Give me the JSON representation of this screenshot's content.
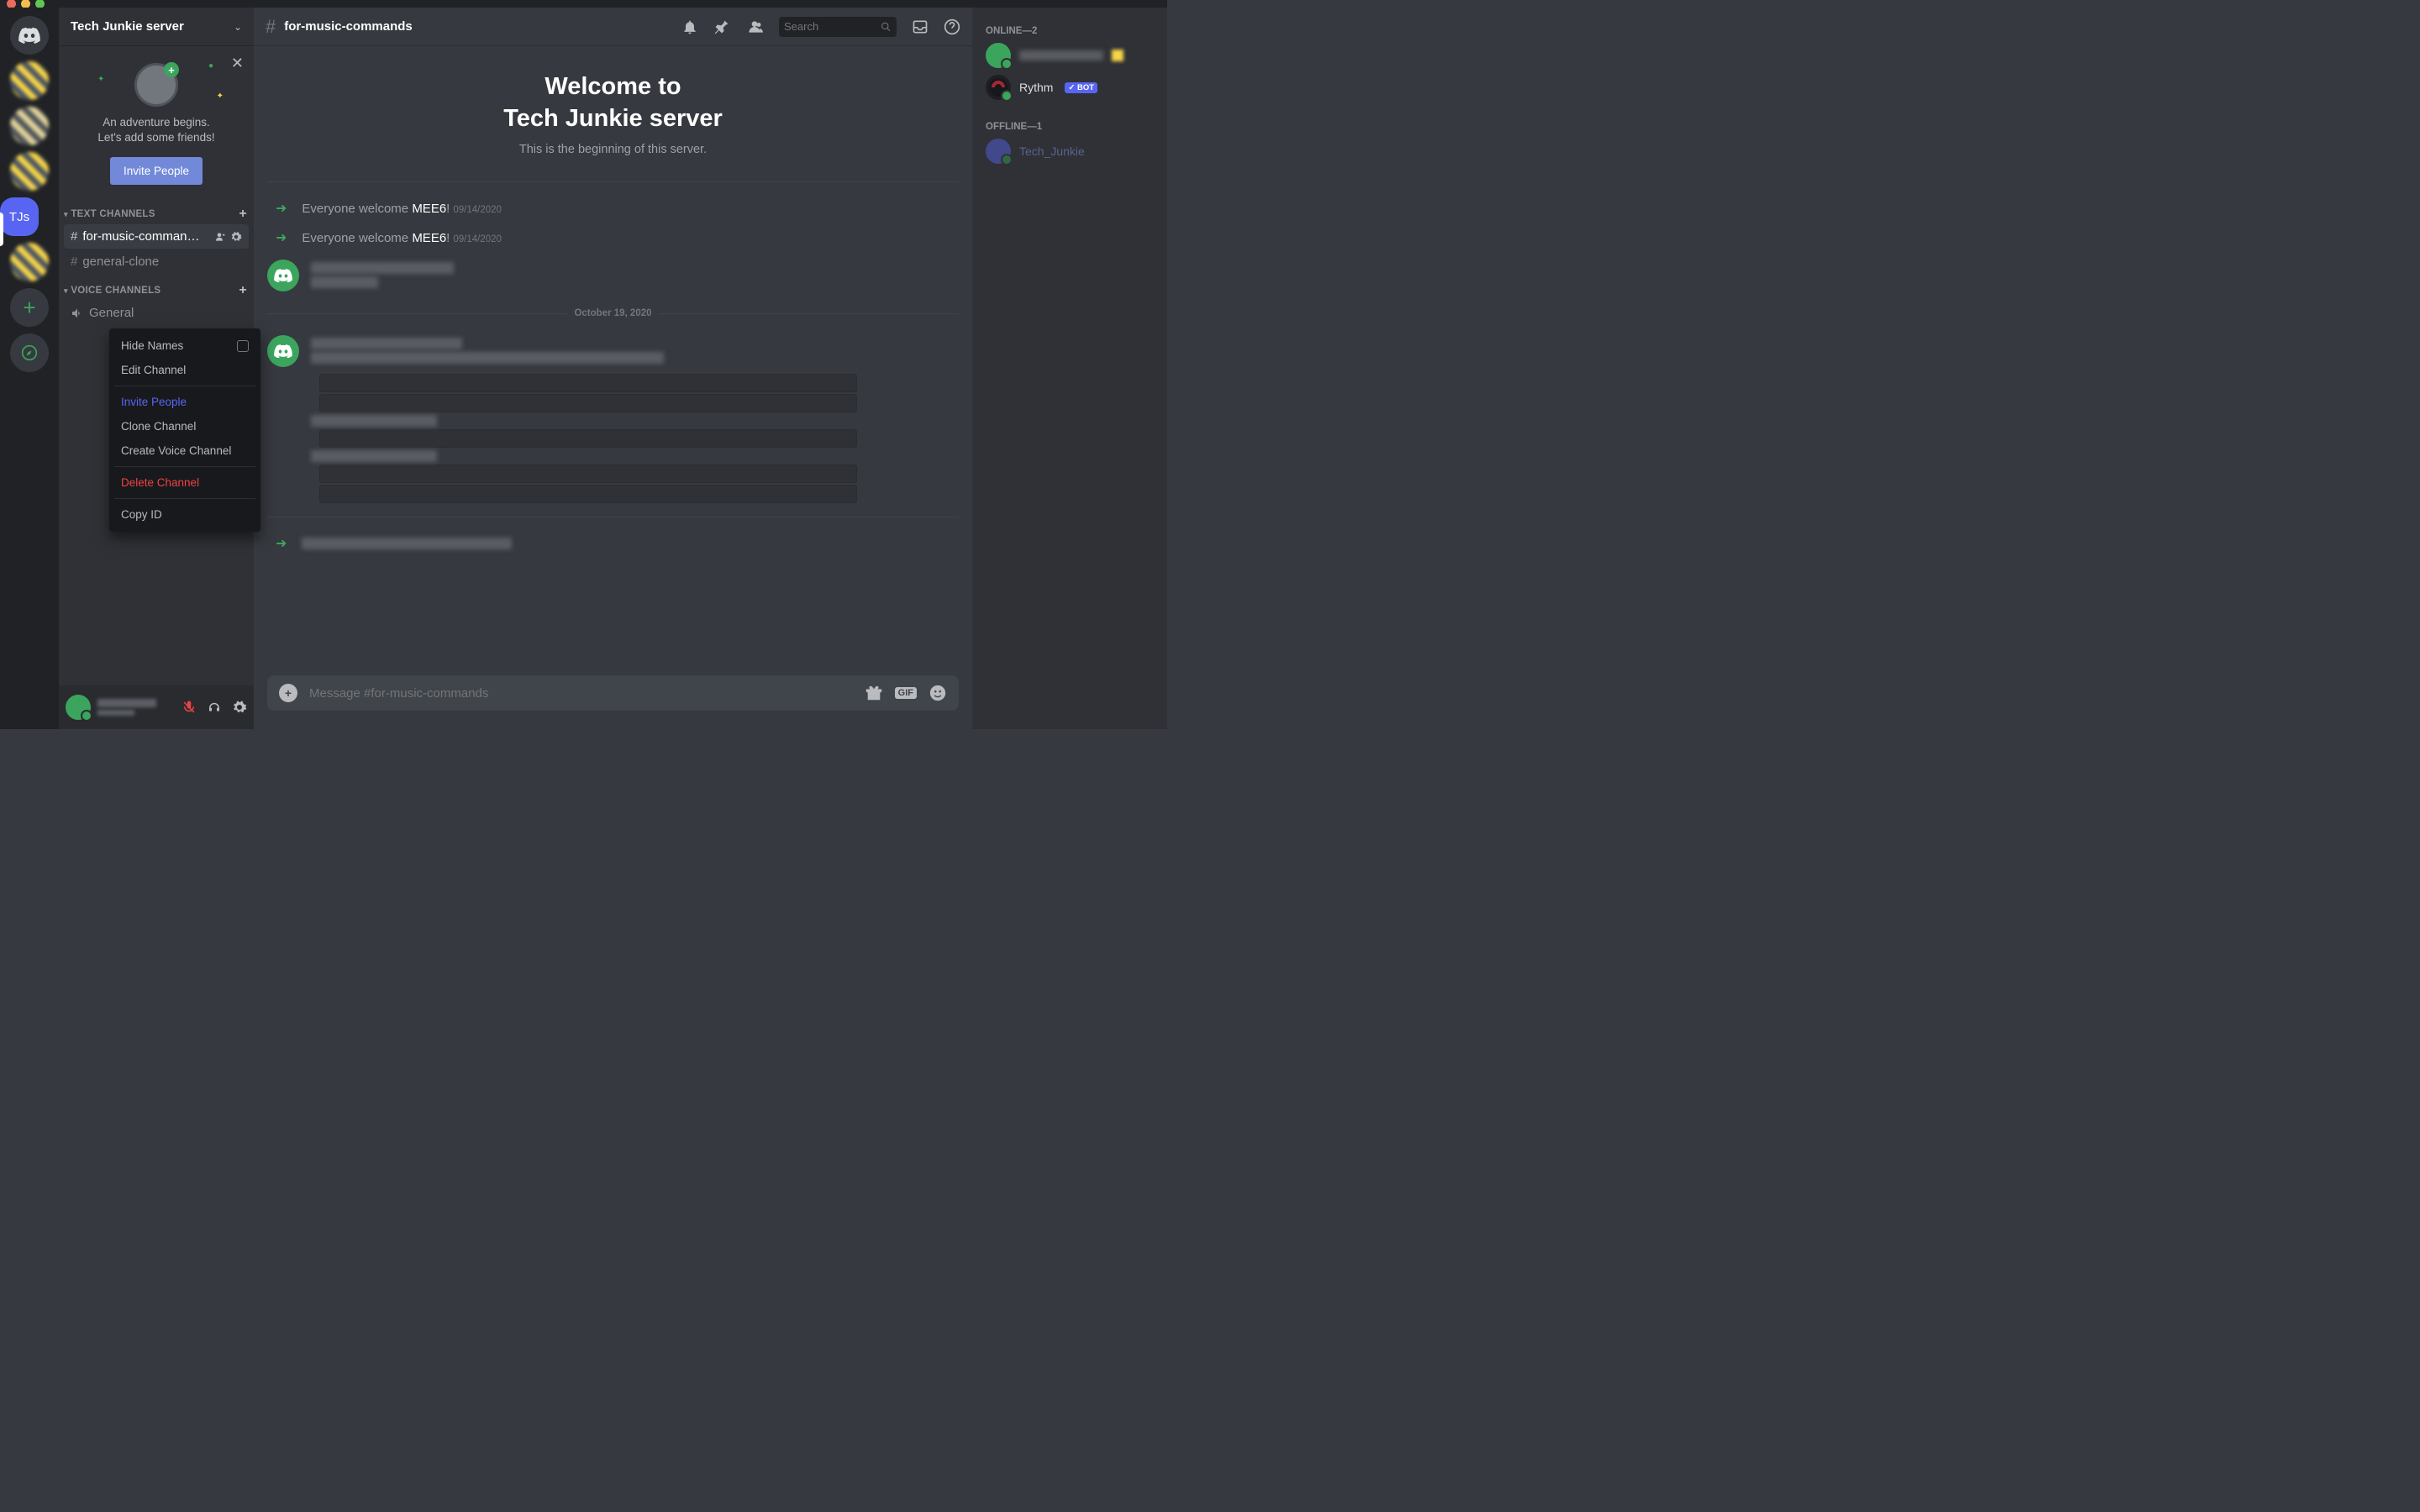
{
  "server": {
    "name": "Tech Junkie server",
    "abbrev": "TJs"
  },
  "invite_card": {
    "line1": "An adventure begins.",
    "line2": "Let's add some friends!",
    "button": "Invite People"
  },
  "categories": {
    "text_label": "TEXT CHANNELS",
    "voice_label": "VOICE CHANNELS"
  },
  "channels": {
    "text": [
      {
        "name": "for-music-comman…",
        "active": true
      },
      {
        "name": "general-clone",
        "active": false
      }
    ],
    "voice": [
      {
        "name": "General"
      }
    ]
  },
  "context_menu": {
    "hide_names": "Hide Names",
    "edit_channel": "Edit Channel",
    "invite_people": "Invite People",
    "clone_channel": "Clone Channel",
    "create_voice": "Create Voice Channel",
    "delete_channel": "Delete Channel",
    "copy_id": "Copy ID"
  },
  "chat": {
    "channel_name": "for-music-commands",
    "welcome_line1": "Welcome to",
    "welcome_line2": "Tech Junkie server",
    "welcome_sub": "This is the beginning of this server.",
    "system_messages": [
      {
        "prefix": "Everyone welcome ",
        "name": "MEE6",
        "suffix": "!",
        "date": "09/14/2020"
      },
      {
        "prefix": "Everyone welcome ",
        "name": "MEE6",
        "suffix": "!",
        "date": "09/14/2020"
      }
    ],
    "divider_date": "October 19, 2020",
    "input_placeholder": "Message #for-music-commands"
  },
  "toolbar": {
    "search_placeholder": "Search"
  },
  "members": {
    "online_label": "ONLINE—2",
    "offline_label": "OFFLINE—1",
    "online": [
      {
        "name": "██████",
        "color": "#3ba55d"
      },
      {
        "name": "Rythm",
        "color": "#a52834",
        "bot": true,
        "bot_label": "✓ BOT"
      }
    ],
    "offline": [
      {
        "name": "Tech_Junkie"
      }
    ]
  },
  "icons": {
    "gif": "GIF"
  }
}
